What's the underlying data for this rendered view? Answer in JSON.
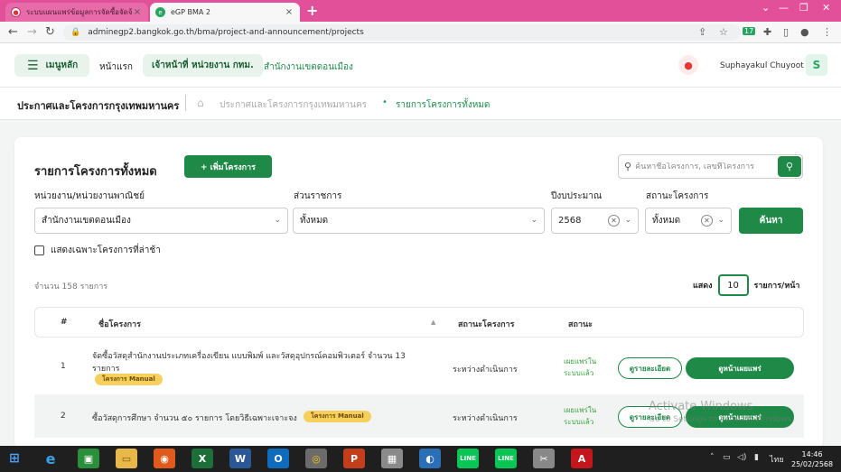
{
  "browser": {
    "tabs": [
      {
        "title": "ระบบแผนแพร่ข้อมูลการจัดซื้อจัดจ้างฯ",
        "active": false
      },
      {
        "title": "eGP BMA 2",
        "active": true
      }
    ],
    "url": "adminegp2.bangkok.go.th/bma/project-and-announcement/projects",
    "ext_badge": "17"
  },
  "header": {
    "menu_label": "เมนูหลัก",
    "nav": [
      "หน้าแรก",
      "เจ้าหน้าที่ หน่วยงาน กทม.",
      "สำนักงานเขตดอนเมือง"
    ],
    "user_name": "Suphayakul Chuyoot",
    "avatar_letter": "S"
  },
  "breadcrumb": {
    "page_title": "ประกาศและโครงการกรุงเทพมหานคร",
    "items": [
      "ประกาศและโครงการกรุงเทพมหานคร",
      "รายการโครงการทั้งหมด"
    ]
  },
  "main": {
    "title": "รายการโครงการทั้งหมด",
    "add_button": "+ เพิ่มโครงการ",
    "search_placeholder": "ค้นหาชื่อโครงการ, เลขที่โครงการ",
    "filters": {
      "agency_label": "หน่วยงาน/หน่วยงานพาณิชย์",
      "agency_value": "สำนักงานเขตดอนเมือง",
      "division_label": "ส่วนราชการ",
      "division_value": "ทั้งหมด",
      "year_label": "ปีงบประมาณ",
      "year_value": "2568",
      "status_label": "สถานะโครงการ",
      "status_value": "ทั้งหมด",
      "search_button": "ค้นหา"
    },
    "late_only_label": "แสดงเฉพาะโครงการที่ล่าช้า",
    "count_text": "จำนวน  158  รายการ",
    "per_page": {
      "show": "แสดง",
      "value": "10",
      "unit": "รายการ/หน้า"
    }
  },
  "table": {
    "headers": [
      "#",
      "ชื่อโครงการ",
      "สถานะโครงการ",
      "สถานะ"
    ],
    "rows": [
      {
        "no": "1",
        "name_line1": "จัดซื้อวัสดุสำนักงานประเภทเครื่องเขียน แบบพิมพ์ และวัสดุอุปกรณ์คอมพิวเตอร์ จำนวน 13",
        "name_line2": "รายการ",
        "badge": "โครงการ Manual",
        "project_status": "ระหว่างดำเนินการ",
        "publish_line1": "เผยแพร่ใน",
        "publish_line2": "ระบบแล้ว",
        "detail_button": "ดูรายละเอียด",
        "page_button": "ดูหน้าเผยแพร่"
      },
      {
        "no": "2",
        "name_line1": "ซื้อวัสดุการศึกษา จำนวน ๕๐ รายการ โดยวิธีเฉพาะเจาะจง",
        "name_line2": "",
        "badge": "โครงการ Manual",
        "project_status": "ระหว่างดำเนินการ",
        "publish_line1": "เผยแพร่ใน",
        "publish_line2": "ระบบแล้ว",
        "detail_button": "ดูรายละเอียด",
        "page_button": "ดูหน้าเผยแพร่"
      }
    ]
  },
  "os": {
    "watermark_title": "Activate Windows",
    "watermark_sub": "Go to Settings to activate Windows.",
    "lang": "ไทย",
    "time": "14:46",
    "date": "25/02/2568"
  }
}
